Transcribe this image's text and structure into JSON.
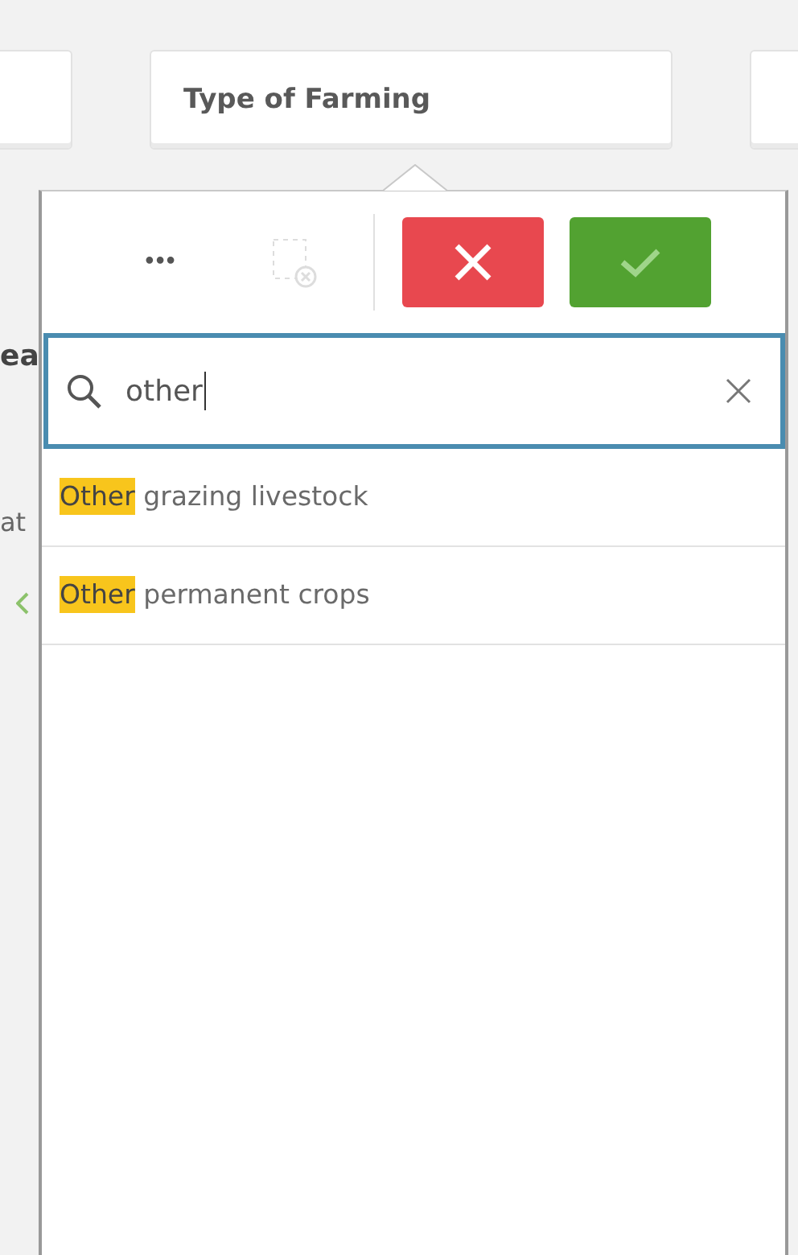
{
  "filter_title": "Type of Farming",
  "background_fragments": [
    "ea",
    "at"
  ],
  "toolbar": {
    "more": "•••"
  },
  "search": {
    "value": "other"
  },
  "results": [
    {
      "match": "Other",
      "rest": " grazing livestock"
    },
    {
      "match": "Other",
      "rest": " permanent crops"
    }
  ]
}
